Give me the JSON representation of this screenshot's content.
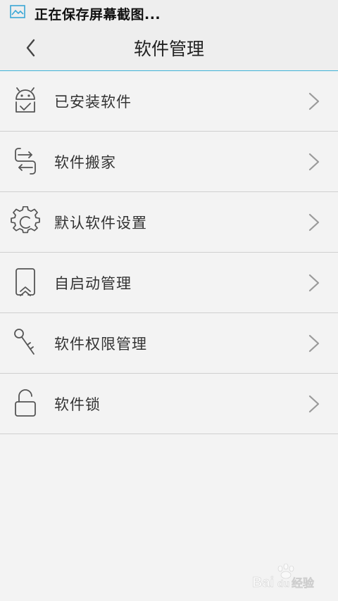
{
  "status_bar": {
    "text": "正在保存屏幕截图...",
    "icon": "screenshot-icon"
  },
  "header": {
    "title": "软件管理",
    "back_icon": "chevron-left-icon"
  },
  "menu": {
    "items": [
      {
        "label": "已安装软件",
        "icon": "android-installed-icon"
      },
      {
        "label": "软件搬家",
        "icon": "transfer-icon"
      },
      {
        "label": "默认软件设置",
        "icon": "gear-icon"
      },
      {
        "label": "自启动管理",
        "icon": "autostart-icon"
      },
      {
        "label": "软件权限管理",
        "icon": "key-icon"
      },
      {
        "label": "软件锁",
        "icon": "unlock-icon"
      }
    ]
  },
  "colors": {
    "accent_line": "#3fb3d8",
    "background": "#f3f3f3",
    "header_bg": "#eeeeee",
    "divider": "#cfcfcf",
    "chevron": "#9a9a9a"
  }
}
